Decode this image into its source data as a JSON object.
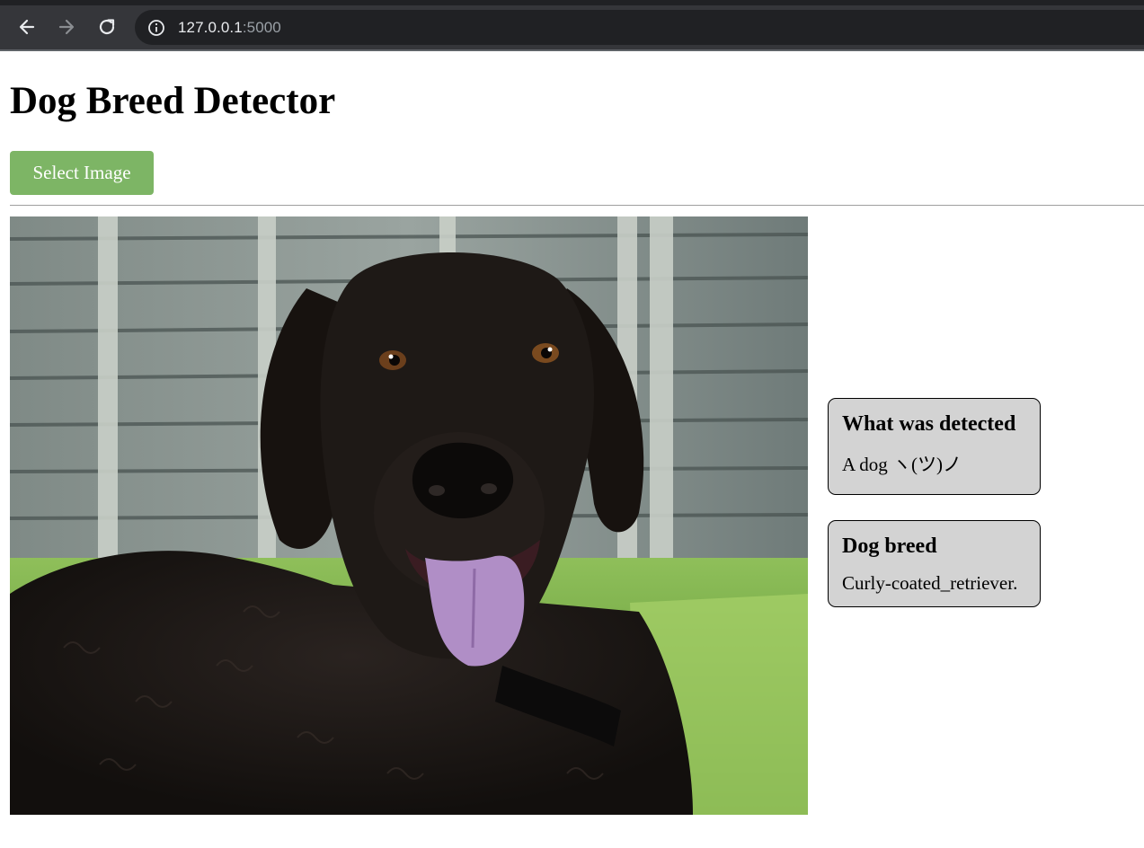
{
  "browser": {
    "back_icon": "arrow-left-icon",
    "forward_icon": "arrow-right-icon",
    "reload_icon": "reload-icon",
    "site_info_icon": "info-icon",
    "url_host": "127.0.0.1",
    "url_port": ":5000"
  },
  "page": {
    "title": "Dog Breed Detector",
    "select_button_label": "Select Image",
    "select_button_color": "#7db565"
  },
  "image": {
    "alt": "Curly-coated retriever photo"
  },
  "results": {
    "detected_heading": "What was detected",
    "detected_text": "A dog ヽ(ツ)ノ",
    "breed_heading": "Dog breed",
    "breed_text": "Curly-coated_retriever."
  }
}
